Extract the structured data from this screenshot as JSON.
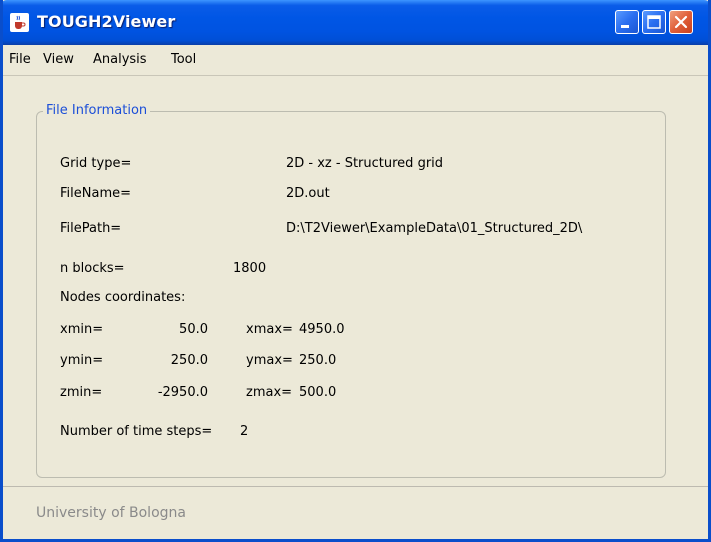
{
  "window": {
    "title": "TOUGH2Viewer",
    "icon": "java-cup-icon"
  },
  "menu": {
    "items": [
      "File",
      "View",
      "Analysis",
      "Tool"
    ]
  },
  "file_info": {
    "group_title": "File Information",
    "grid_type_label": "Grid type=",
    "grid_type_value": "2D - xz - Structured grid",
    "filename_label": "FileName=",
    "filename_value": "2D.out",
    "filepath_label": "FilePath=",
    "filepath_value": "D:\\T2Viewer\\ExampleData\\01_Structured_2D\\",
    "nblocks_label": "n blocks=",
    "nblocks_value": "1800",
    "nodes_label": "Nodes coordinates:",
    "xmin_label": "xmin=",
    "xmin_value": "50.0",
    "xmax_label": "xmax=",
    "xmax_value": "4950.0",
    "ymin_label": "ymin=",
    "ymin_value": "250.0",
    "ymax_label": "ymax=",
    "ymax_value": "250.0",
    "zmin_label": "zmin=",
    "zmin_value": "-2950.0",
    "zmax_label": "zmax=",
    "zmax_value": "500.0",
    "timesteps_label": "Number of time steps=",
    "timesteps_value": "2"
  },
  "status": {
    "text": "University of Bologna"
  },
  "colors": {
    "titlebar": "#0054e3",
    "group_title": "#1c4fd8",
    "window_bg": "#ece9d8",
    "close_button": "#e0603a"
  }
}
